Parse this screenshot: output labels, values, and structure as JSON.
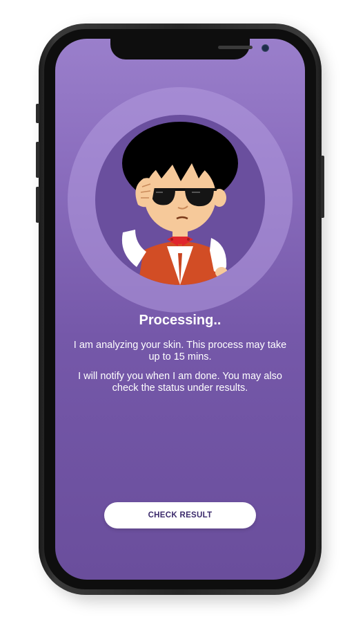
{
  "screen": {
    "title": "Processing..",
    "paragraphs": [
      "I am analyzing your skin. This process may take up to 15 mins.",
      "I will notify you when I am done. You may also check the status under results."
    ],
    "cta_label": "CHECK RESULT"
  },
  "illustration": {
    "name": "cartoon-boy-sunglasses",
    "colors": {
      "hair": "#000000",
      "skin": "#f6c99a",
      "vest": "#d24d25",
      "shirt": "#ffffff",
      "bowtie": "#e0262c"
    }
  },
  "colors": {
    "background_top": "#9a7fcb",
    "background_bottom": "#6a4e9c",
    "button_text": "#3b2a6b",
    "button_bg": "#ffffff"
  }
}
